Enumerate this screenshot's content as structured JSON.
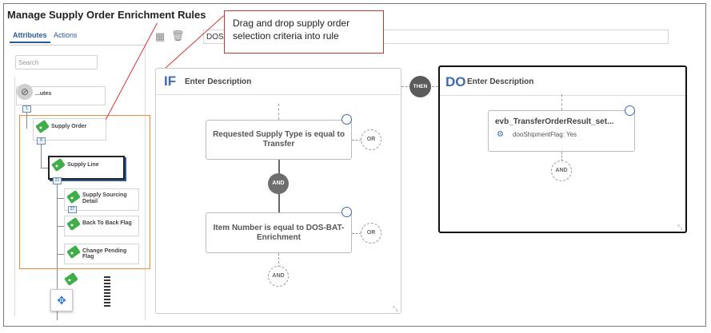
{
  "page": {
    "title": "Manage Supply Order Enrichment Rules"
  },
  "tabs": [
    {
      "label": "Attributes",
      "active": true
    },
    {
      "label": "Actions",
      "active": false
    }
  ],
  "search": {
    "placeholder": "Search"
  },
  "tree": {
    "root_label": "Attributes",
    "root_label_visible": "...utes",
    "root_count": "1",
    "supply_order": {
      "label": "Supply Order",
      "count": "8"
    },
    "supply_line": {
      "label": "Supply Line",
      "count": "21"
    },
    "children": [
      {
        "label": "Supply Sourcing Detail",
        "count": "27"
      },
      {
        "label": "Back To Back Flag"
      },
      {
        "label": "Change Pending Flag"
      }
    ]
  },
  "toolbar": {
    "description_value": "DOS"
  },
  "callout": {
    "text": "Drag and drop supply order selection criteria into rule"
  },
  "if_panel": {
    "keyword": "IF",
    "description_placeholder": "Enter Description",
    "conditions": [
      {
        "text": "Requested Supply Type is equal to Transfer"
      },
      {
        "text": "Item Number is equal to DOS-BAT-Enrichment"
      }
    ],
    "or_label": "OR",
    "and_label": "AND"
  },
  "then_label": "THEN",
  "do_panel": {
    "keyword": "DO",
    "description_placeholder": "Enter Description",
    "action": {
      "title": "evb_TransferOrderResult_set...",
      "detail": "dooShipmentFlag: Yes"
    },
    "and_label": "AND"
  },
  "colors": {
    "accent_blue": "#3d6ab0",
    "tag_green": "#3fae49",
    "highlight_orange": "#f08a3c",
    "callout_red": "#c0392b"
  },
  "icons": [
    "grid-icon",
    "trash-icon",
    "compass-icon",
    "move-icon",
    "gear-icon",
    "tag-icon",
    "resize-icon"
  ]
}
